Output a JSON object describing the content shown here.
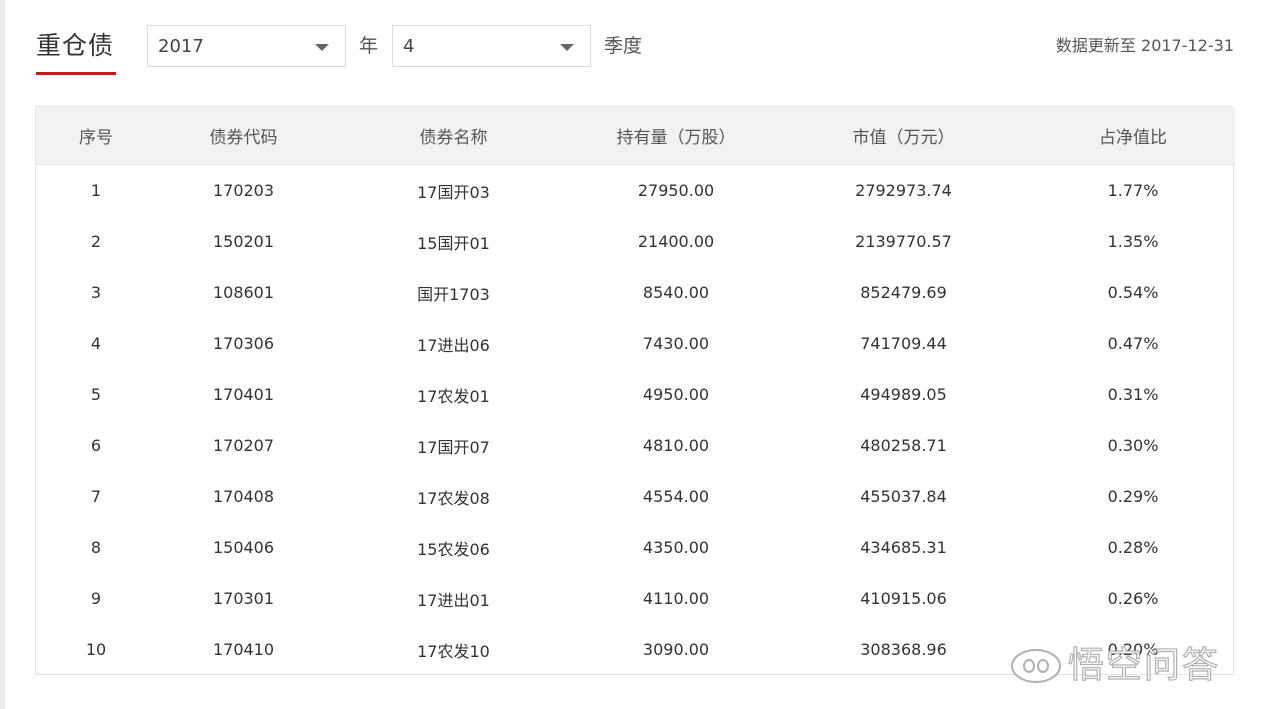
{
  "title": "重仓债",
  "filters": {
    "year": "2017",
    "year_unit": "年",
    "quarter": "4",
    "quarter_unit": "季度"
  },
  "update_text": "数据更新至 2017-12-31",
  "table": {
    "headers": [
      "序号",
      "债券代码",
      "债券名称",
      "持有量（万股）",
      "市值（万元）",
      "占净值比"
    ],
    "rows": [
      [
        "1",
        "170203",
        "17国开03",
        "27950.00",
        "2792973.74",
        "1.77%"
      ],
      [
        "2",
        "150201",
        "15国开01",
        "21400.00",
        "2139770.57",
        "1.35%"
      ],
      [
        "3",
        "108601",
        "国开1703",
        "8540.00",
        "852479.69",
        "0.54%"
      ],
      [
        "4",
        "170306",
        "17进出06",
        "7430.00",
        "741709.44",
        "0.47%"
      ],
      [
        "5",
        "170401",
        "17农发01",
        "4950.00",
        "494989.05",
        "0.31%"
      ],
      [
        "6",
        "170207",
        "17国开07",
        "4810.00",
        "480258.71",
        "0.30%"
      ],
      [
        "7",
        "170408",
        "17农发08",
        "4554.00",
        "455037.84",
        "0.29%"
      ],
      [
        "8",
        "150406",
        "15农发06",
        "4350.00",
        "434685.31",
        "0.28%"
      ],
      [
        "9",
        "170301",
        "17进出01",
        "4110.00",
        "410915.06",
        "0.26%"
      ],
      [
        "10",
        "170410",
        "17农发10",
        "3090.00",
        "308368.96",
        "0.20%"
      ]
    ]
  },
  "watermark": {
    "text": "悟空问答",
    "icon": "wukong-logo-icon"
  },
  "colors": {
    "accent": "#c8161d",
    "header_bg": "#f2f2f2",
    "border": "#e3e3e3"
  }
}
